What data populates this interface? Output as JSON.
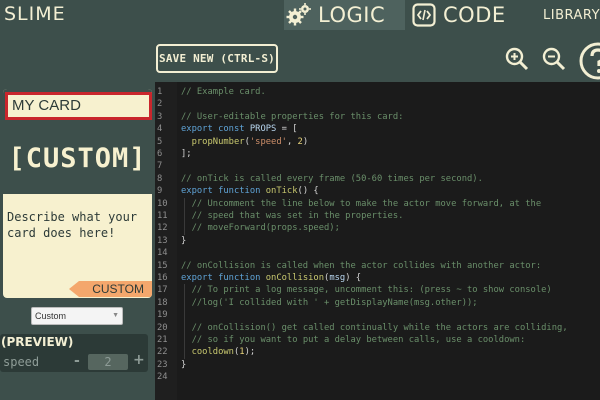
{
  "app": {
    "logo": "SLIME"
  },
  "tabs": {
    "logic": "LOGIC",
    "code": "CODE",
    "library": "LIBRARY"
  },
  "toolbar": {
    "save_label": "SAVE NEW (CTRL-S)"
  },
  "card": {
    "name": "MY CARD",
    "art_text": "[CUSTOM]",
    "description_line1": "Describe what your",
    "description_line2": "card does here!",
    "type_tag": "CUSTOM"
  },
  "type_select": {
    "selected": "Custom"
  },
  "preview": {
    "title": "(PREVIEW)",
    "prop_name": "speed",
    "prop_value": "2",
    "minus": "-",
    "plus": "+"
  },
  "editor": {
    "lines": [
      {
        "n": "1",
        "text": "// Example card."
      },
      {
        "n": "2",
        "text": ""
      },
      {
        "n": "3",
        "text": "// User-editable properties for this card:"
      },
      {
        "n": "4",
        "text": "export const PROPS = ["
      },
      {
        "n": "5",
        "text": "  propNumber('speed', 2)"
      },
      {
        "n": "6",
        "text": "];"
      },
      {
        "n": "7",
        "text": ""
      },
      {
        "n": "8",
        "text": "// onTick is called every frame (50-60 times per second)."
      },
      {
        "n": "9",
        "text": "export function onTick() {"
      },
      {
        "n": "10",
        "text": "  // Uncomment the line below to make the actor move forward, at the"
      },
      {
        "n": "11",
        "text": "  // speed that was set in the properties."
      },
      {
        "n": "12",
        "text": "  // moveForward(props.speed);"
      },
      {
        "n": "13",
        "text": "}"
      },
      {
        "n": "14",
        "text": ""
      },
      {
        "n": "15",
        "text": "// onCollision is called when the actor collides with another actor:"
      },
      {
        "n": "16",
        "text": "export function onCollision(msg) {"
      },
      {
        "n": "17",
        "text": "  // To print a log message, uncomment this: (press ~ to show console)"
      },
      {
        "n": "18",
        "text": "  //log('I collided with ' + getDisplayName(msg.other));"
      },
      {
        "n": "19",
        "text": ""
      },
      {
        "n": "20",
        "text": "  // onCollision() get called continually while the actors are colliding,"
      },
      {
        "n": "21",
        "text": "  // so if you want to put a delay between calls, use a cooldown:"
      },
      {
        "n": "22",
        "text": "  cooldown(1);"
      },
      {
        "n": "23",
        "text": "}"
      },
      {
        "n": "24",
        "text": ""
      }
    ]
  },
  "icons": {
    "logic": "gears-icon",
    "code": "code-brackets-icon",
    "zoom_in": "zoom-in-icon",
    "zoom_out": "zoom-out-icon",
    "help": "help-icon"
  },
  "colors": {
    "background": "#3d4f4b",
    "cream": "#f3efd3",
    "highlight_red": "#c9262c",
    "tag_orange": "#f4a76c",
    "editor_bg": "#1b1b1b"
  }
}
